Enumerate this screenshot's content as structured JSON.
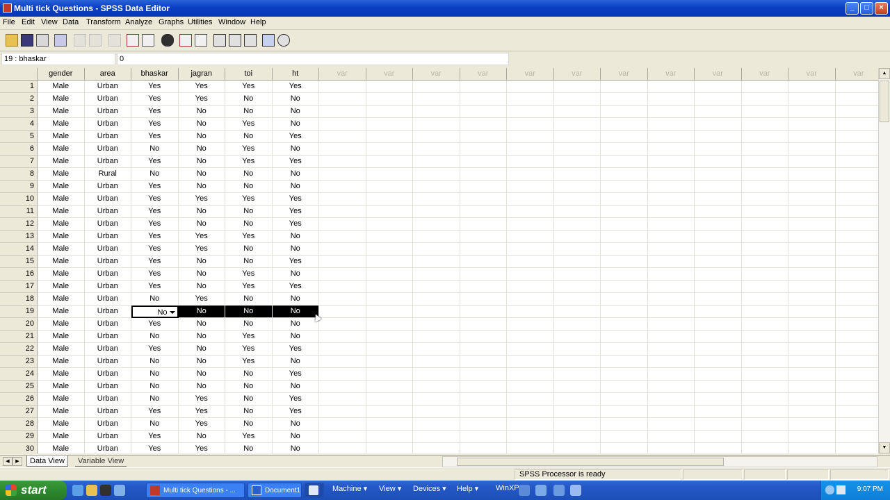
{
  "window": {
    "title": "Multi tick Questions - SPSS Data Editor",
    "controls": [
      "_",
      "□",
      "×"
    ]
  },
  "menubar": [
    "File",
    "Edit",
    "View",
    "Data",
    "Transform",
    "Analyze",
    "Graphs",
    "Utilities",
    "Window",
    "Help"
  ],
  "toolbar": {
    "icons": [
      "open-icon",
      "save-icon",
      "print-icon",
      "dialog-recall-icon",
      "undo-icon",
      "redo-icon",
      "goto-chart-icon",
      "goto-case-icon",
      "variables-icon",
      "find-icon",
      "insert-case-icon",
      "insert-variable-icon",
      "split-file-icon",
      "weight-cases-icon",
      "select-cases-icon",
      "value-labels-icon",
      "use-sets-icon"
    ]
  },
  "cell_editor": {
    "reference": "19 : bhaskar",
    "value": "0"
  },
  "grid": {
    "columns": [
      "gender",
      "area",
      "bhaskar",
      "jagran",
      "toi",
      "ht"
    ],
    "empty_column_label": "var",
    "empty_column_count": 12,
    "rows": [
      [
        "Male",
        "Urban",
        "Yes",
        "Yes",
        "Yes",
        "Yes"
      ],
      [
        "Male",
        "Urban",
        "Yes",
        "Yes",
        "No",
        "No"
      ],
      [
        "Male",
        "Urban",
        "Yes",
        "No",
        "No",
        "No"
      ],
      [
        "Male",
        "Urban",
        "Yes",
        "No",
        "Yes",
        "No"
      ],
      [
        "Male",
        "Urban",
        "Yes",
        "No",
        "No",
        "Yes"
      ],
      [
        "Male",
        "Urban",
        "No",
        "No",
        "Yes",
        "No"
      ],
      [
        "Male",
        "Urban",
        "Yes",
        "No",
        "Yes",
        "Yes"
      ],
      [
        "Male",
        "Rural",
        "No",
        "No",
        "No",
        "No"
      ],
      [
        "Male",
        "Urban",
        "Yes",
        "No",
        "No",
        "No"
      ],
      [
        "Male",
        "Urban",
        "Yes",
        "Yes",
        "Yes",
        "Yes"
      ],
      [
        "Male",
        "Urban",
        "Yes",
        "No",
        "No",
        "Yes"
      ],
      [
        "Male",
        "Urban",
        "Yes",
        "No",
        "No",
        "Yes"
      ],
      [
        "Male",
        "Urban",
        "Yes",
        "Yes",
        "Yes",
        "No"
      ],
      [
        "Male",
        "Urban",
        "Yes",
        "Yes",
        "No",
        "No"
      ],
      [
        "Male",
        "Urban",
        "Yes",
        "No",
        "No",
        "Yes"
      ],
      [
        "Male",
        "Urban",
        "Yes",
        "No",
        "Yes",
        "No"
      ],
      [
        "Male",
        "Urban",
        "Yes",
        "No",
        "Yes",
        "Yes"
      ],
      [
        "Male",
        "Urban",
        "No",
        "Yes",
        "No",
        "No"
      ],
      [
        "Male",
        "Urban",
        "No",
        "No",
        "No",
        "No"
      ],
      [
        "Male",
        "Urban",
        "Yes",
        "No",
        "No",
        "No"
      ],
      [
        "Male",
        "Urban",
        "No",
        "No",
        "Yes",
        "No"
      ],
      [
        "Male",
        "Urban",
        "Yes",
        "No",
        "Yes",
        "Yes"
      ],
      [
        "Male",
        "Urban",
        "No",
        "No",
        "Yes",
        "No"
      ],
      [
        "Male",
        "Urban",
        "No",
        "No",
        "No",
        "Yes"
      ],
      [
        "Male",
        "Urban",
        "No",
        "No",
        "No",
        "No"
      ],
      [
        "Male",
        "Urban",
        "No",
        "Yes",
        "No",
        "Yes"
      ],
      [
        "Male",
        "Urban",
        "Yes",
        "Yes",
        "No",
        "Yes"
      ],
      [
        "Male",
        "Urban",
        "No",
        "Yes",
        "No",
        "No"
      ],
      [
        "Male",
        "Urban",
        "Yes",
        "No",
        "Yes",
        "No"
      ],
      [
        "Male",
        "Urban",
        "Yes",
        "Yes",
        "No",
        "No"
      ]
    ],
    "active_row": 19,
    "active_column": "bhaskar",
    "selected_columns_in_active_row": [
      "jagran",
      "toi",
      "ht"
    ]
  },
  "tabs": [
    {
      "label": "Data View",
      "active": true
    },
    {
      "label": "Variable View",
      "active": false
    }
  ],
  "status": {
    "message": "SPSS Processor  is ready"
  },
  "taskbar": {
    "start_label": "start",
    "tasks": [
      {
        "label": "Multi tick Questions - ...",
        "active": false
      },
      {
        "label": "Document1",
        "active": false
      },
      {
        "label": "",
        "active": true
      }
    ],
    "vm_menus": [
      "Machine ▾",
      "View ▾",
      "Devices ▾",
      "Help ▾",
      "WinXP"
    ],
    "clock": "9:07 PM"
  },
  "colors": {
    "titlebar": "#0a3fc4",
    "selection": "#000000",
    "taskbar": "#2458c6",
    "start": "#2d8a2d"
  }
}
